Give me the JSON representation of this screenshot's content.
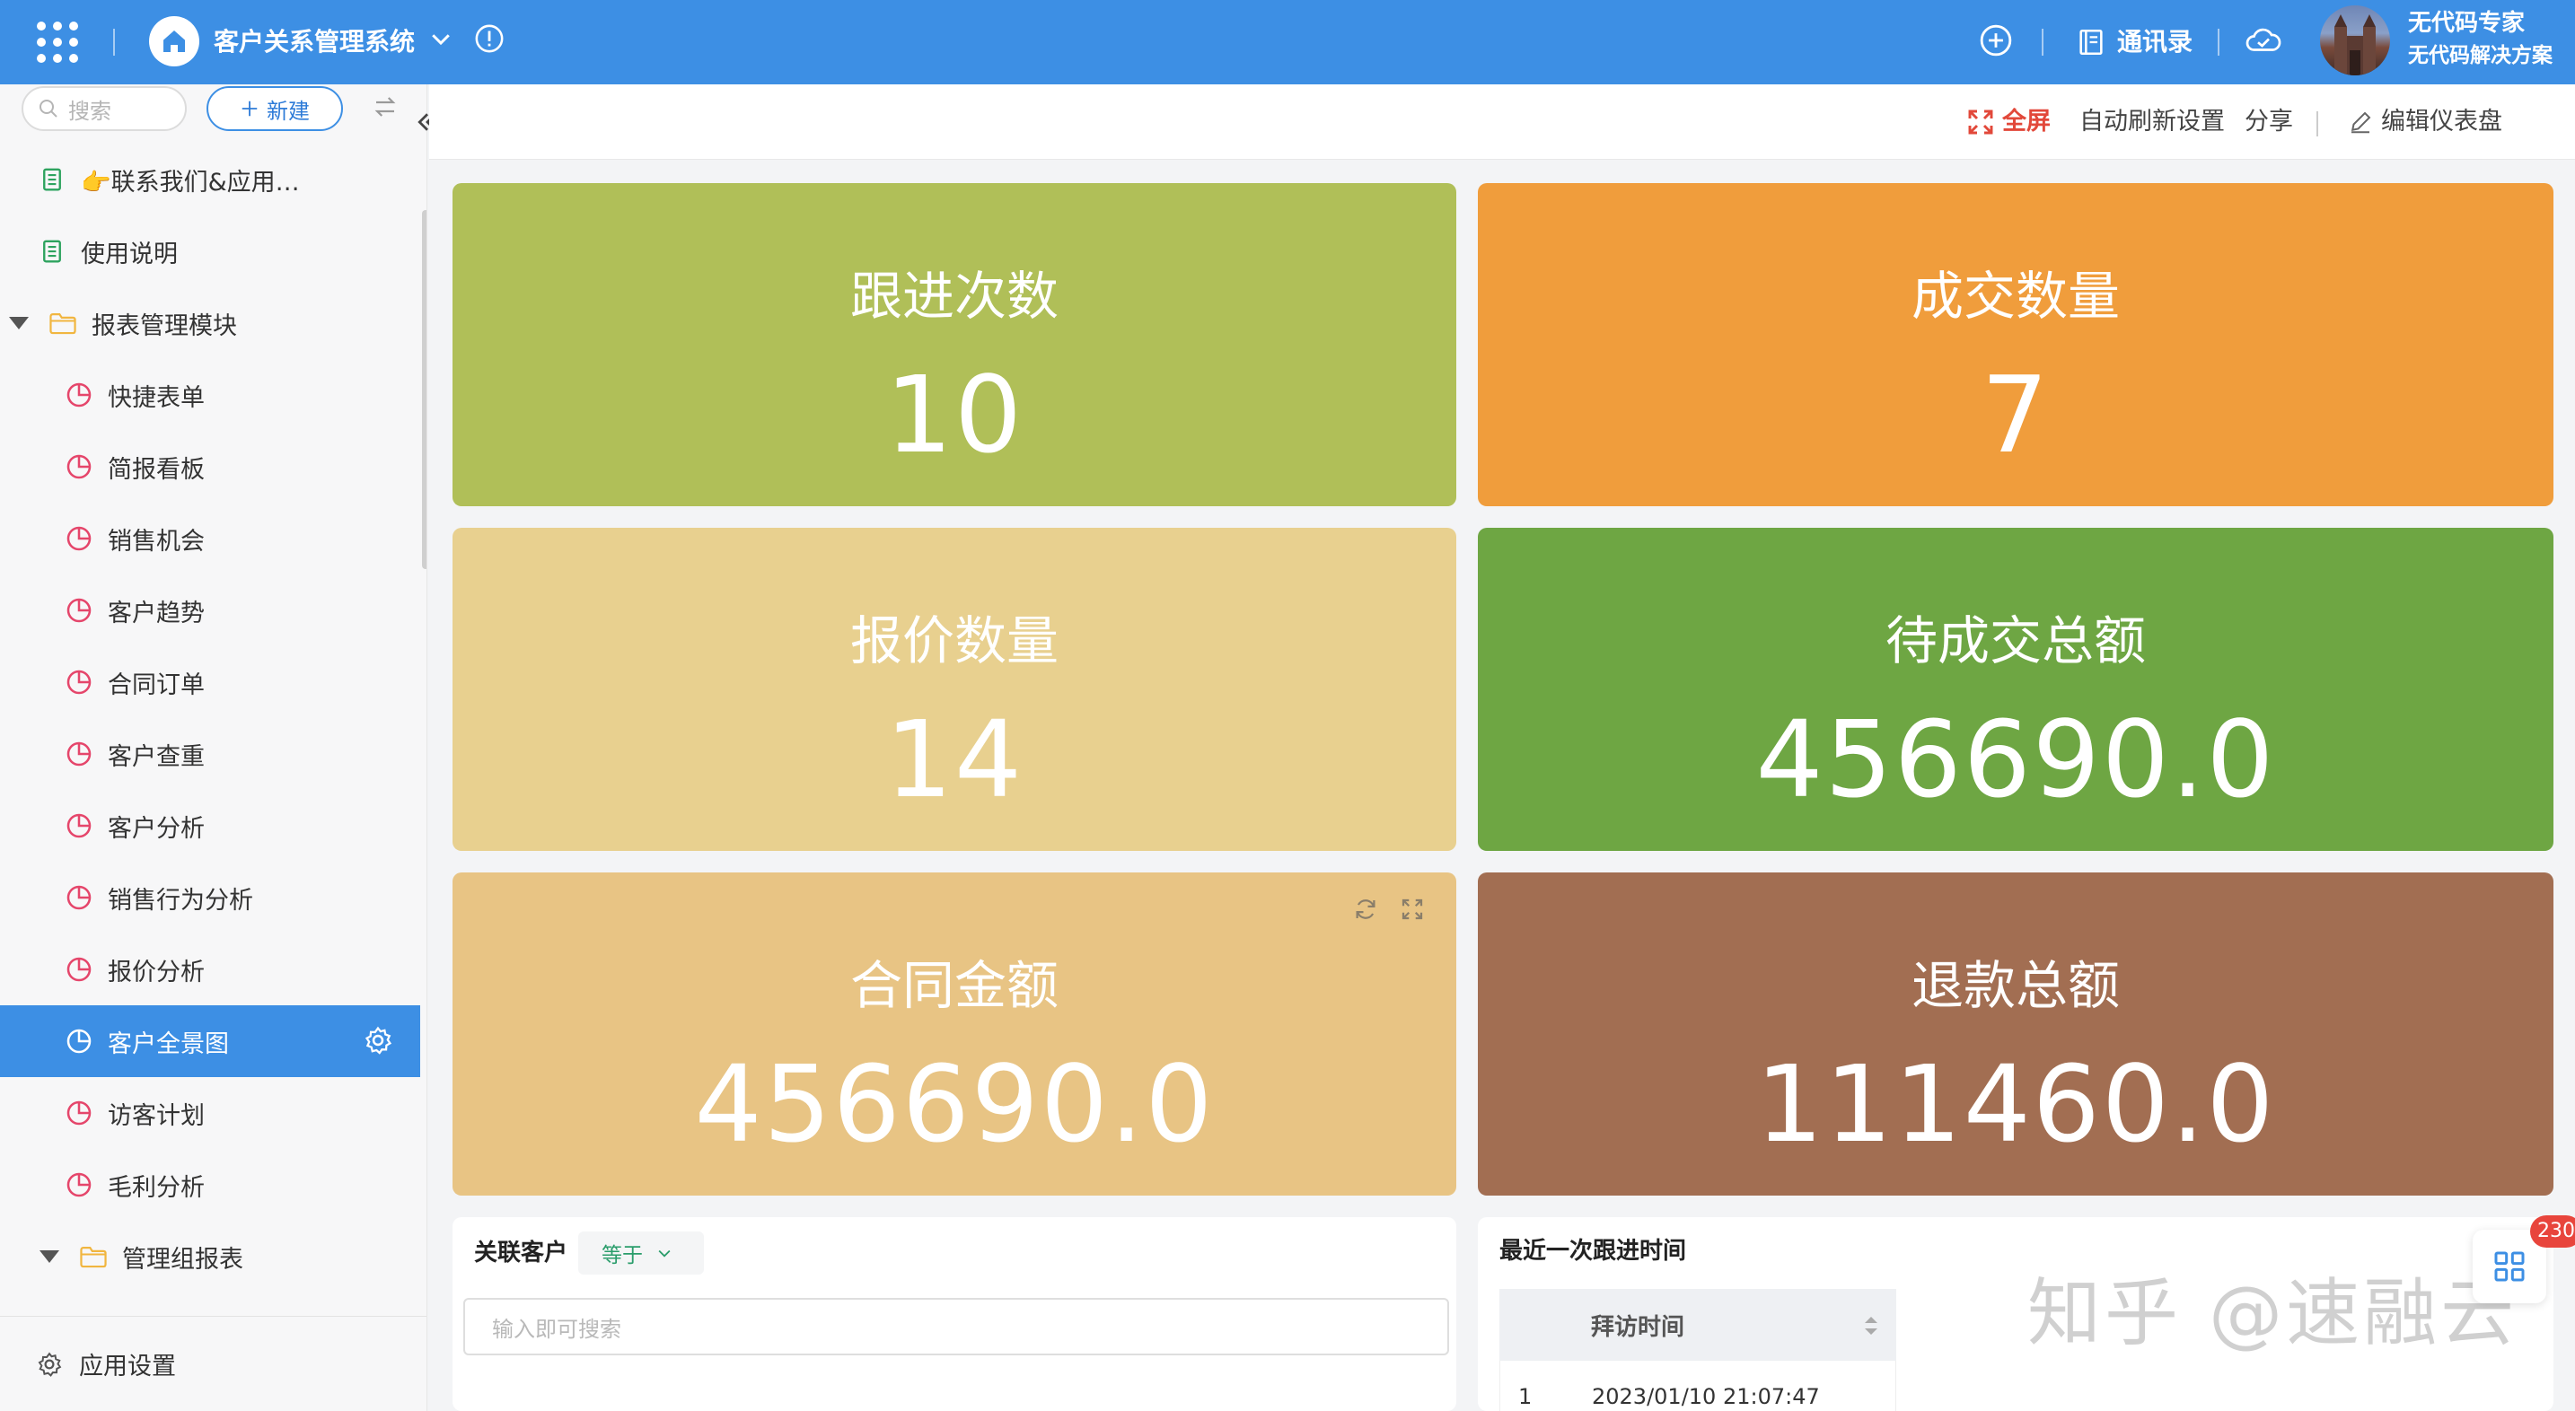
{
  "header": {
    "app_title": "客户关系管理系统",
    "contacts_label": "通讯录",
    "user_name": "无代码专家",
    "user_subtitle": "无代码解决方案"
  },
  "sidebar": {
    "search_placeholder": "搜索",
    "new_label": "新建",
    "items": [
      {
        "label": "👉联系我们&应用…",
        "icon": "document-icon",
        "level": 0
      },
      {
        "label": "使用说明",
        "icon": "document-icon",
        "level": 0
      },
      {
        "label": "报表管理模块",
        "icon": "folder-icon",
        "level": 0,
        "expanded": true
      },
      {
        "label": "快捷表单",
        "icon": "pie-chart-icon",
        "level": 1
      },
      {
        "label": "简报看板",
        "icon": "pie-chart-icon",
        "level": 1
      },
      {
        "label": "销售机会",
        "icon": "pie-chart-icon",
        "level": 1
      },
      {
        "label": "客户趋势",
        "icon": "pie-chart-icon",
        "level": 1
      },
      {
        "label": "合同订单",
        "icon": "pie-chart-icon",
        "level": 1
      },
      {
        "label": "客户查重",
        "icon": "pie-chart-icon",
        "level": 1
      },
      {
        "label": "客户分析",
        "icon": "pie-chart-icon",
        "level": 1
      },
      {
        "label": "销售行为分析",
        "icon": "pie-chart-icon",
        "level": 1
      },
      {
        "label": "报价分析",
        "icon": "pie-chart-icon",
        "level": 1
      },
      {
        "label": "客户全景图",
        "icon": "pie-chart-icon",
        "level": 1,
        "active": true
      },
      {
        "label": "访客计划",
        "icon": "pie-chart-icon",
        "level": 1
      },
      {
        "label": "毛利分析",
        "icon": "pie-chart-icon",
        "level": 1
      },
      {
        "label": "管理组报表",
        "icon": "folder-icon",
        "level": 1,
        "expanded": true
      }
    ],
    "settings_label": "应用设置"
  },
  "toolbar": {
    "fullscreen_label": "全屏",
    "auto_refresh_label": "自动刷新设置",
    "share_label": "分享",
    "edit_label": "编辑仪表盘"
  },
  "cards": [
    {
      "title": "跟进次数",
      "value": "10",
      "color": "#b0bf58"
    },
    {
      "title": "成交数量",
      "value": "7",
      "color": "#f09d3c"
    },
    {
      "title": "报价数量",
      "value": "14",
      "color": "#e8d08f"
    },
    {
      "title": "待成交总额",
      "value": "456690.0",
      "color": "#6ea643"
    },
    {
      "title": "合同金额",
      "value": "456690.0",
      "color": "#e8c484"
    },
    {
      "title": "退款总额",
      "value": "111460.0",
      "color": "#a26e52"
    }
  ],
  "filter_panel": {
    "label": "关联客户",
    "operator": "等于",
    "placeholder": "输入即可搜索"
  },
  "table_panel": {
    "title": "最近一次跟进时间",
    "column": "拜访时间",
    "rows": [
      {
        "index": "1",
        "value": "2023/01/10 21:07:47"
      }
    ]
  },
  "watermark": "知乎 @速融云",
  "notification_count": "230"
}
